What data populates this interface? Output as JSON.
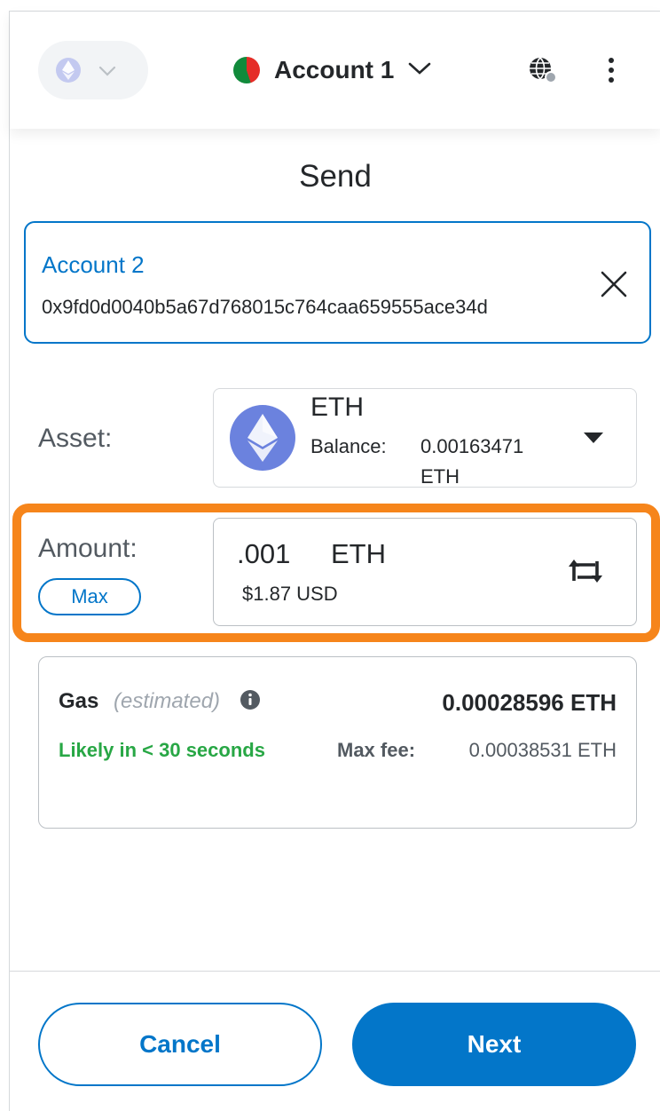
{
  "header": {
    "network_icon": "eth-icon",
    "network_chevron_icon": "chevron-down-icon",
    "account_name": "Account 1",
    "account_chevron_icon": "chevron-down-icon",
    "connection_icon": "globe-icon",
    "menu_icon": "kebab-menu-icon"
  },
  "page": {
    "title": "Send"
  },
  "recipient": {
    "name": "Account 2",
    "address": "0x9fd0d0040b5a67d768015c764caa659555ace34d",
    "clear_icon": "close-icon"
  },
  "asset": {
    "label": "Asset:",
    "symbol": "ETH",
    "balance_label": "Balance:",
    "balance_amount": "0.00163471",
    "balance_unit": "ETH"
  },
  "amount": {
    "label": "Amount:",
    "max_label": "Max",
    "value": ".001",
    "unit": "ETH",
    "fiat": "$1.87 USD",
    "swap_icon": "swap-icon"
  },
  "gas": {
    "title": "Gas",
    "estimated": "(estimated)",
    "amount": "0.00028596 ETH",
    "time": "Likely in < 30 seconds",
    "max_fee_label": "Max fee:",
    "max_fee_value": "0.00038531 ETH"
  },
  "footer": {
    "cancel_label": "Cancel",
    "next_label": "Next"
  },
  "colors": {
    "primary": "#0376c9",
    "highlight": "#f6851b",
    "success": "#28a745",
    "text": "#24272a"
  }
}
